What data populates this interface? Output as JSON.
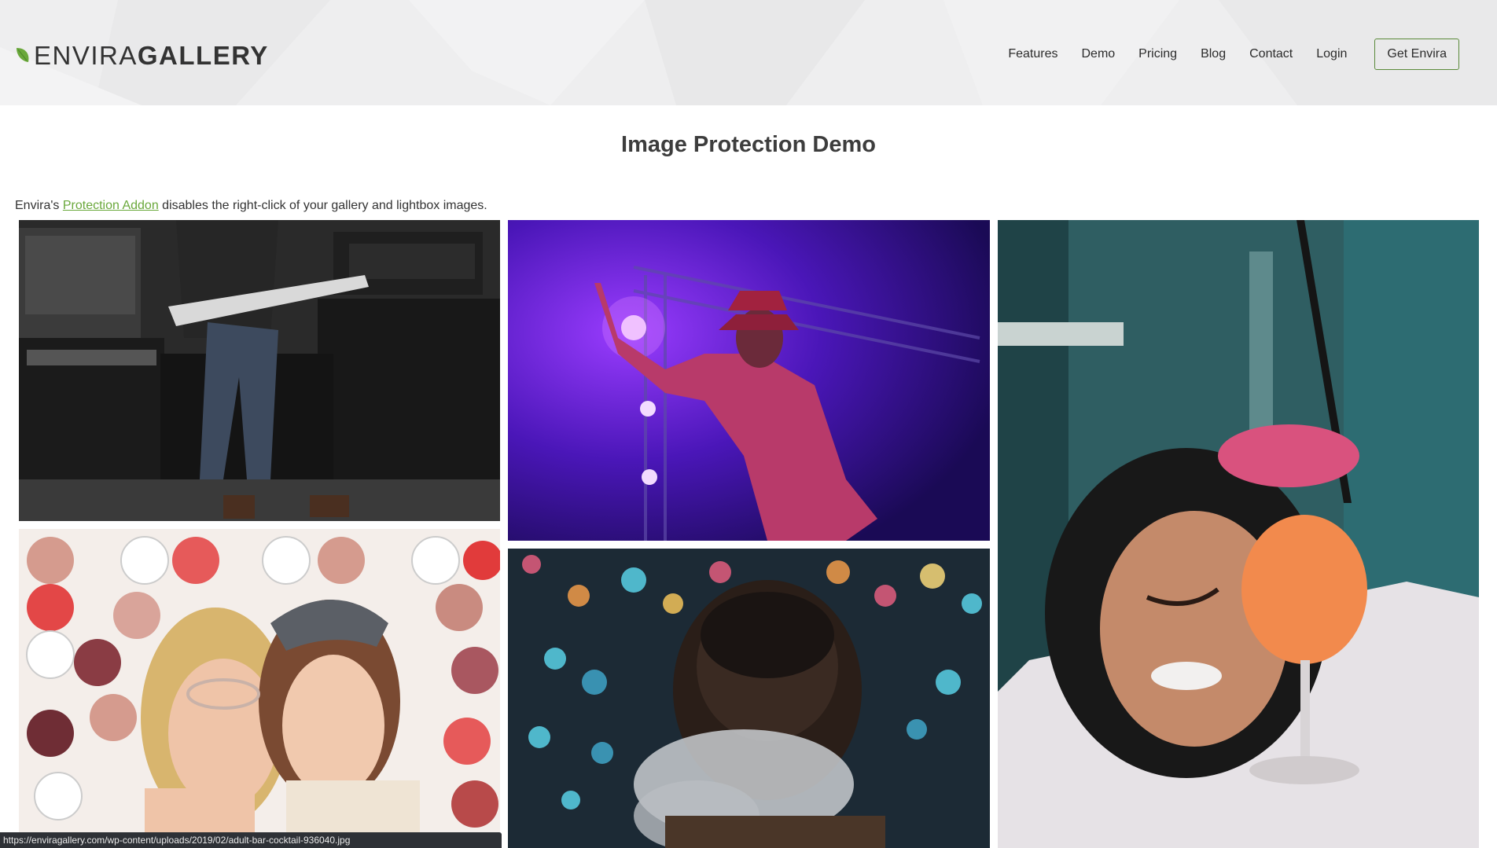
{
  "header": {
    "logo_light": "ENVIRA",
    "logo_bold": "GALLERY",
    "nav": [
      {
        "label": "Features"
      },
      {
        "label": "Demo"
      },
      {
        "label": "Pricing"
      },
      {
        "label": "Blog"
      },
      {
        "label": "Contact"
      },
      {
        "label": "Login"
      }
    ],
    "cta_label": "Get Envira"
  },
  "main": {
    "title": "Image Protection Demo",
    "intro_prefix": "Envira's ",
    "intro_link": "Protection Addon",
    "intro_suffix": " disables the right-click of your gallery and lightbox images."
  },
  "status_bar": {
    "url": "https://enviragallery.com/wp-content/uploads/2019/02/adult-bar-cocktail-936040.jpg"
  },
  "colors": {
    "brand_green": "#6aa83b",
    "header_bg": "#eeeeef",
    "button_border": "#5a8a3a"
  }
}
